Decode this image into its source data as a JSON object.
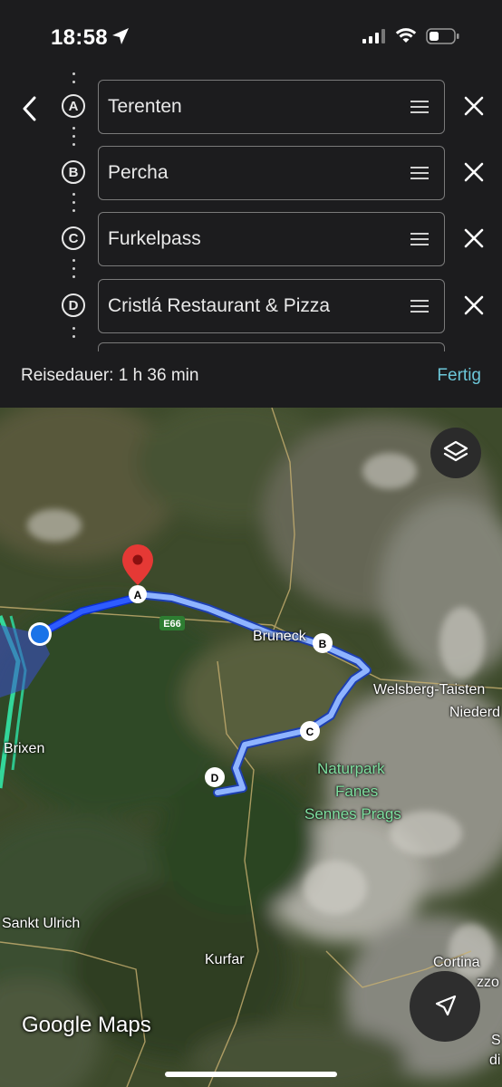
{
  "status": {
    "time": "18:58"
  },
  "icons": {
    "back": "chevron-left-icon",
    "drag": "drag-handle-icon",
    "remove": "close-icon",
    "layers": "layers-icon",
    "navigate": "navigation-arrow-icon",
    "pin": "map-pin-icon"
  },
  "stops": [
    {
      "letter": "A",
      "name": "Terenten"
    },
    {
      "letter": "B",
      "name": "Percha"
    },
    {
      "letter": "C",
      "name": "Furkelpass"
    },
    {
      "letter": "D",
      "name": "Cristlá Restaurant & Pizza"
    }
  ],
  "summary": {
    "duration": "Reisedauer: 1 h 36 min",
    "done_label": "Fertig"
  },
  "map": {
    "labels": {
      "brixen": "Brixen",
      "bruneck": "Bruneck",
      "welsberg": "Welsberg-Taisten",
      "niederdorf": "Niederd",
      "park1": "Naturpark",
      "park2": "Fanes",
      "park3": "Sennes Prags",
      "sankt_ulrich": "Sankt Ulrich",
      "kurfar": "Kurfar",
      "cortina": "Cortina",
      "ampezzo": "zzo",
      "road": "E66",
      "edge_s": "S",
      "edge_di": "di"
    },
    "markers": {
      "a": "A",
      "b": "B",
      "c": "C",
      "d": "D"
    },
    "brand": "Google Maps",
    "route_color": "#8fb4ff",
    "route_active_color": "#1a4fff"
  }
}
